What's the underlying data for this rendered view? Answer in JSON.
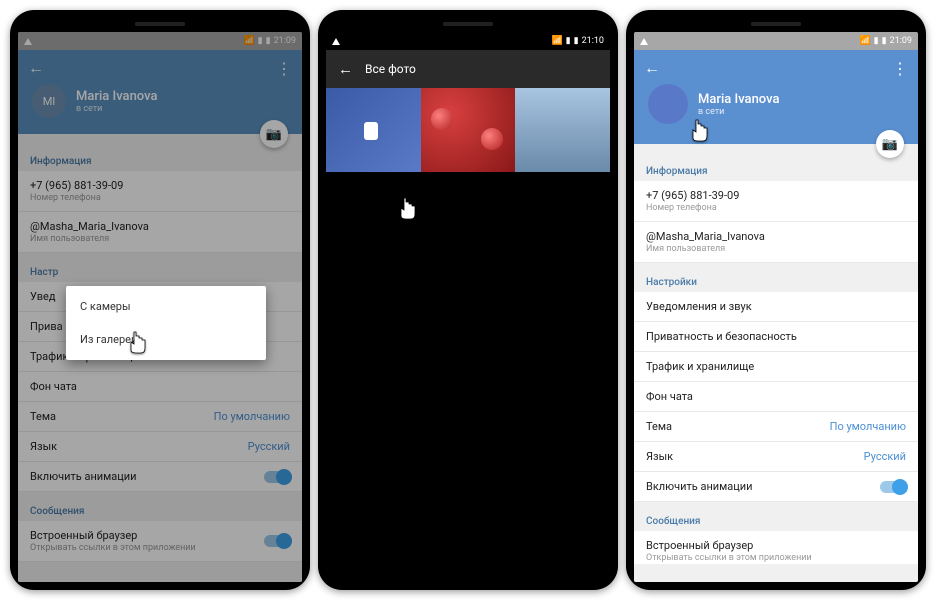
{
  "statusbar": {
    "time1": "21:09",
    "time2": "21:10",
    "time3": "21:09"
  },
  "screen1": {
    "profile": {
      "initials": "MI",
      "name": "Maria Ivanova",
      "status": "в сети"
    },
    "info_title": "Информация",
    "phone": "+7 (965) 881-39-09",
    "phone_sub": "Номер телефона",
    "username": "@Masha_Maria_Ivanova",
    "username_sub": "Имя пользователя",
    "settings_title": "Настр",
    "rows": {
      "notifications": "Увед",
      "privacy": "Прива",
      "traffic": "Трафик и хранилище",
      "chatbg": "Фон чата",
      "theme": "Тема",
      "theme_value": "По умолчанию",
      "language": "Язык",
      "language_value": "Русский",
      "animations": "Включить анимации"
    },
    "messages_title": "Сообщения",
    "browser": "Встроенный браузер",
    "browser_sub": "Открывать ссылки в этом приложении",
    "popup": {
      "camera": "С камеры",
      "gallery": "Из галереи"
    }
  },
  "screen2": {
    "title": "Все фото"
  },
  "screen3": {
    "profile": {
      "name": "Maria Ivanova",
      "status": "в сети"
    },
    "info_title": "Информация",
    "phone": "+7 (965) 881-39-09",
    "phone_sub": "Номер телефона",
    "username": "@Masha_Maria_Ivanova",
    "username_sub": "Имя пользователя",
    "settings_title": "Настройки",
    "rows": {
      "notifications": "Уведомления и звук",
      "privacy": "Приватность и безопасность",
      "traffic": "Трафик и хранилище",
      "chatbg": "Фон чата",
      "theme": "Тема",
      "theme_value": "По умолчанию",
      "language": "Язык",
      "language_value": "Русский",
      "animations": "Включить анимации"
    },
    "messages_title": "Сообщения",
    "browser": "Встроенный браузер",
    "browser_sub": "Открывать ссылки в этом приложении"
  }
}
